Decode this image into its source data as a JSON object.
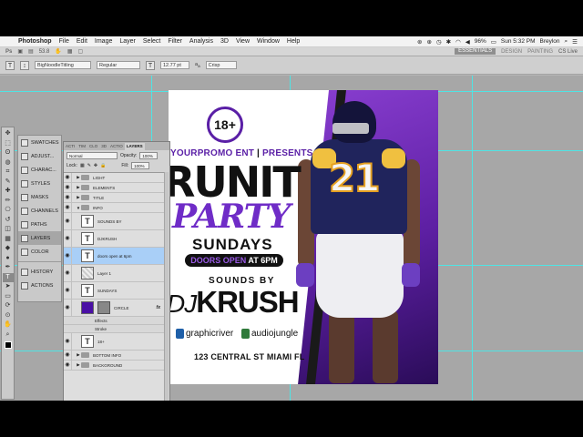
{
  "menubar": {
    "app": "Photoshop",
    "items": [
      "File",
      "Edit",
      "Image",
      "Layer",
      "Select",
      "Filter",
      "Analysis",
      "3D",
      "View",
      "Window",
      "Help"
    ],
    "battery": "96%",
    "clock": "Sun 5:32 PM",
    "user": "Breylon"
  },
  "optionsbar": {
    "ps_badge": "Ps",
    "zoom": "53.8",
    "workspaces": [
      "ESSENTIALS",
      "DESIGN",
      "PAINTING"
    ],
    "cs_live": "CS Live"
  },
  "tool_options": {
    "font_family": "BigNoodleTitling",
    "font_style": "Regular",
    "font_size": "12.77 pt",
    "antialias": "Crisp"
  },
  "tools_panel": {
    "icons": [
      "move-icon",
      "marquee-icon",
      "lasso-icon",
      "quick-select-icon",
      "crop-icon",
      "eyedropper-icon",
      "healing-icon",
      "brush-icon",
      "stamp-icon",
      "history-brush-icon",
      "eraser-icon",
      "gradient-icon",
      "blur-icon",
      "dodge-icon",
      "pen-icon",
      "type-icon",
      "path-select-icon",
      "shape-icon",
      "3d-rotate-icon",
      "3d-orbit-icon",
      "hand-icon",
      "zoom-icon"
    ],
    "glyphs": [
      "✥",
      "⬚",
      "ʘ",
      "◍",
      "⌗",
      "✎",
      "✚",
      "✏",
      "⎔",
      "↺",
      "◫",
      "▦",
      "◆",
      "●",
      "✒",
      "T",
      "➤",
      "▭",
      "⟳",
      "⊙",
      "✋",
      "⌕"
    ],
    "active_index": 15
  },
  "dock": {
    "group1": [
      "SWATCHES",
      "ADJUST...",
      "CHARAC...",
      "STYLES",
      "MASKS",
      "CHANNELS",
      "PATHS",
      "LAYERS",
      "COLOR"
    ],
    "group2": [
      "HISTORY",
      "ACTIONS"
    ],
    "active": "LAYERS"
  },
  "layers_panel": {
    "tabs": [
      "ACTI",
      "TIM",
      "CLO",
      "3D",
      "ACTIO",
      "LAYERS"
    ],
    "active_tab": "LAYERS",
    "blend_mode": "Normal",
    "opacity_label": "Opacity:",
    "opacity_value": "100%",
    "lock_label": "Lock:",
    "fill_label": "Fill:",
    "fill_value": "100%",
    "layers": [
      {
        "type": "group",
        "name": "LIGHT"
      },
      {
        "type": "group",
        "name": "ELEMENTS"
      },
      {
        "type": "group",
        "name": "TITLE"
      },
      {
        "type": "group-open",
        "name": "INFO"
      },
      {
        "type": "text",
        "name": "SOUNDS BY"
      },
      {
        "type": "text",
        "name": "DJKRUSH"
      },
      {
        "type": "text",
        "name": "doors open at 6pm",
        "selected": true
      },
      {
        "type": "pixel",
        "name": "Layer 1"
      },
      {
        "type": "text",
        "name": "SUNDAYS"
      },
      {
        "type": "shape",
        "name": "CIRCLE",
        "fx": "fx"
      },
      {
        "type": "fx-sub",
        "name": "Effects"
      },
      {
        "type": "fx-sub",
        "name": "Stroke"
      },
      {
        "type": "text",
        "name": "18+"
      },
      {
        "type": "group",
        "name": "BOTTOM INFO"
      },
      {
        "type": "group",
        "name": "BACKGROUND"
      }
    ],
    "footer_icons": [
      "∞",
      "fx",
      "◘",
      "◑",
      "▭",
      "▢",
      "🗑"
    ]
  },
  "flyer": {
    "badge": "18+",
    "promo_1": "YOURPROMO ENT",
    "promo_sep": "|",
    "promo_2": "PRESENTS",
    "headline": "RUNIT",
    "subheadline": "PARTY",
    "day": "SUNDAYS",
    "doors_1": "DOORS OPEN",
    "doors_2": "AT 6PM",
    "sounds_by": "SOUNDS BY",
    "dj_1": "DJ",
    "dj_2": "KRUSH",
    "sponsor_1": "graphicriver",
    "sponsor_2": "audiojungle",
    "address": "123 CENTRAL ST MIAMI FL",
    "jersey_number": "21"
  },
  "colors": {
    "accent_purple": "#6f2cc7",
    "selection_blue": "#a9cff7",
    "guide_cyan": "#4fe4e4"
  }
}
